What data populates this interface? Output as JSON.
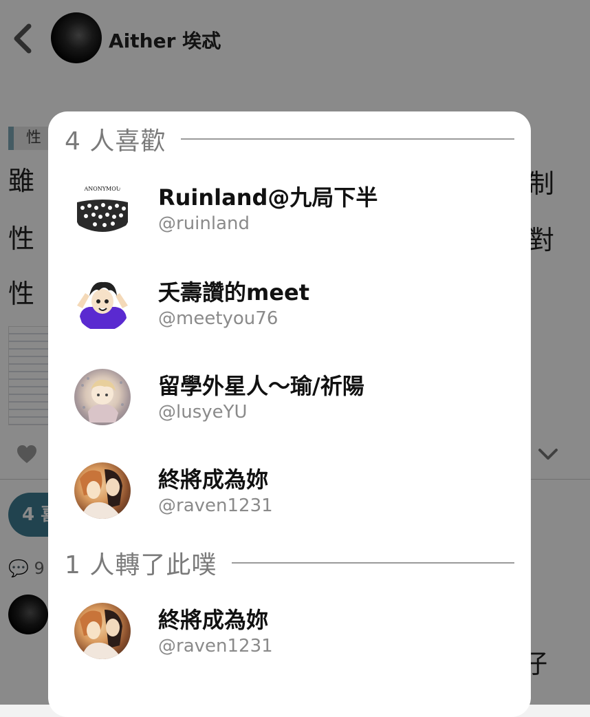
{
  "header": {
    "author_name": "Aither 埃忒",
    "back_label": "<"
  },
  "post": {
    "tag": "性",
    "line1": "雖",
    "line2": "性",
    "line3": "性",
    "tail1": "制",
    "tail2": "對",
    "likes_pill": "4 喜",
    "comment_meta": "9",
    "comment_tail": "仔"
  },
  "modal": {
    "likes_header": "4 人喜歡",
    "replurk_header": "1 人轉了此噗",
    "likers": [
      {
        "name": "Ruinland@九局下半",
        "handle": "@ruinland",
        "avatar_text": "ANONYMOU"
      },
      {
        "name": "夭壽讚的meet",
        "handle": "@meetyou76"
      },
      {
        "name": "留學外星人～瑜/祈陽",
        "handle": "@lusyeYU"
      },
      {
        "name": "終將成為妳",
        "handle": "@raven1231"
      }
    ],
    "replurkers": [
      {
        "name": "終將成為妳",
        "handle": "@raven1231"
      }
    ]
  },
  "colors": {
    "accent": "#3e7d93",
    "overlay": "rgba(0,0,0,0.46)"
  }
}
